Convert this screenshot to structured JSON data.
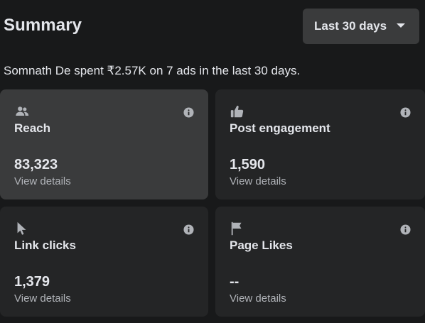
{
  "header": {
    "title": "Summary",
    "range_label": "Last 30 days"
  },
  "summary_text": "Somnath De spent ₹2.57K on 7 ads in the last 30 days.",
  "cards": [
    {
      "metric": "Reach",
      "value": "83,323",
      "details_label": "View details",
      "icon": "people-icon"
    },
    {
      "metric": "Post engagement",
      "value": "1,590",
      "details_label": "View details",
      "icon": "thumbs-up-icon"
    },
    {
      "metric": "Link clicks",
      "value": "1,379",
      "details_label": "View details",
      "icon": "cursor-icon"
    },
    {
      "metric": "Page Likes",
      "value": "--",
      "details_label": "View details",
      "icon": "flag-icon"
    }
  ],
  "colors": {
    "background": "#18191a",
    "card": "#242526",
    "card_highlight": "#3a3b3c",
    "text_primary": "#e4e6eb",
    "text_secondary": "#b0b3b8"
  }
}
